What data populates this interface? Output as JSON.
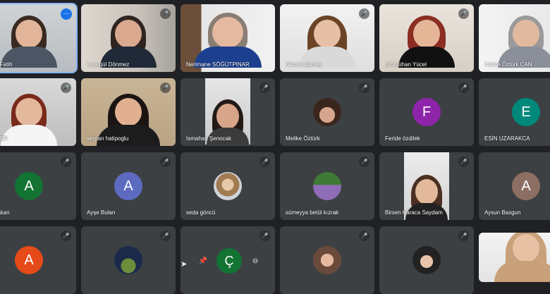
{
  "participants": [
    {
      "name": "Elza Fatih",
      "type": "video"
    },
    {
      "name": "Ayşegül Dönmez",
      "type": "video"
    },
    {
      "name": "Nerimane SÖĞÜTPINAR",
      "type": "video"
    },
    {
      "name": "Gözde Kardeş",
      "type": "video"
    },
    {
      "name": "Ümmühan Yücel",
      "type": "video"
    },
    {
      "name": "Hatice Öztürk CAN",
      "type": "video"
    },
    {
      "name": "GÜNER",
      "type": "video"
    },
    {
      "name": "serpan hatipoglu",
      "type": "video"
    },
    {
      "name": "İsmahan Şenocak",
      "type": "video"
    },
    {
      "name": "Melike Öztürk",
      "type": "photo"
    },
    {
      "name": "Feride özdilek",
      "type": "initial",
      "initial": "F"
    },
    {
      "name": "ESİN UZARAKCA",
      "type": "initial",
      "initial": "E"
    },
    {
      "name": "nur Akan",
      "type": "initial",
      "initial": "A"
    },
    {
      "name": "Ayşe Bulan",
      "type": "initial",
      "initial": "A"
    },
    {
      "name": "seda göncü",
      "type": "photo"
    },
    {
      "name": "sümeyya betül kızrak",
      "type": "photo"
    },
    {
      "name": "Birsen Karaca Saydam",
      "type": "video"
    },
    {
      "name": "Aysun Basgun",
      "type": "initial",
      "initial": "A"
    },
    {
      "name": "",
      "type": "initial",
      "initial": "A"
    },
    {
      "name": "",
      "type": "photo"
    },
    {
      "name": "",
      "type": "initial",
      "initial": "Ç"
    },
    {
      "name": "",
      "type": "photo"
    },
    {
      "name": "",
      "type": "photo"
    },
    {
      "name": "",
      "type": "video"
    }
  ],
  "colors": {
    "background": "#202124",
    "tile": "#3c4043",
    "avatar_purple": "#8e24aa",
    "avatar_teal": "#00897b",
    "avatar_green": "#137333",
    "avatar_blue": "#5c6bc0",
    "avatar_red": "#e64a19",
    "avatar_brown": "#8d6e63",
    "active_outline": "#8ab4f8"
  },
  "icons": {
    "mute": "mic-off-icon",
    "more": "more-options-icon",
    "pin": "pin-icon",
    "remove": "remove-icon"
  }
}
